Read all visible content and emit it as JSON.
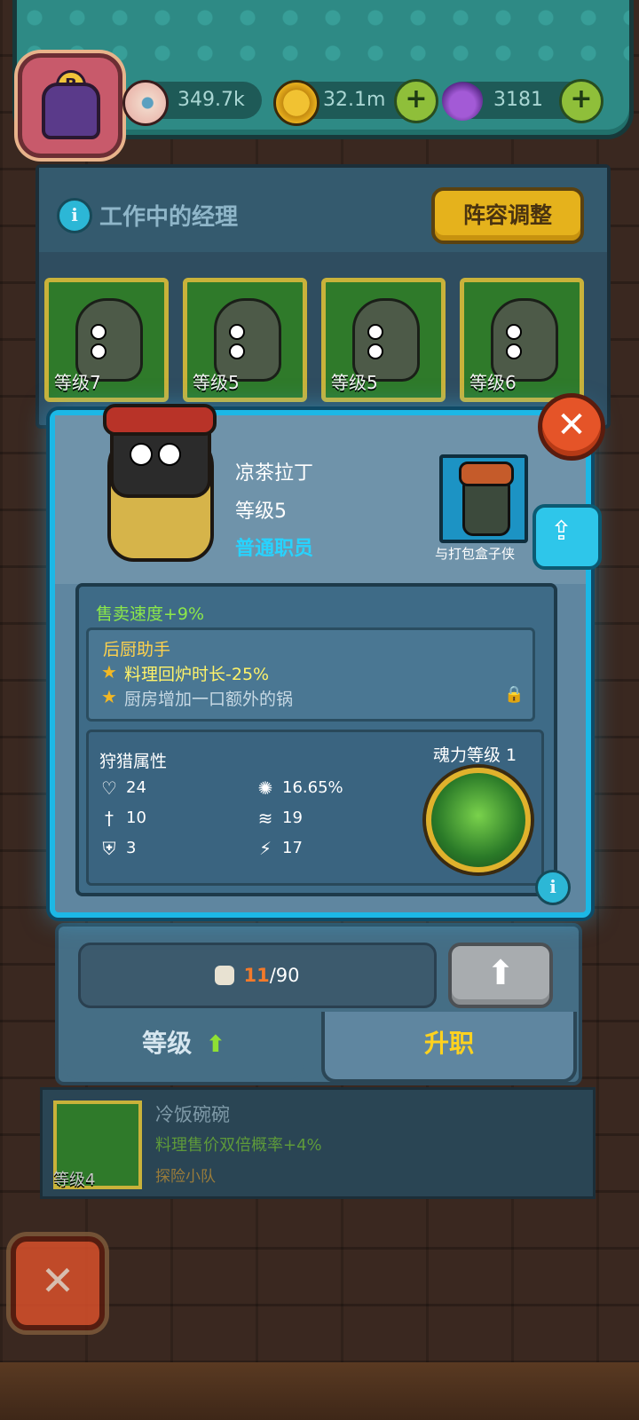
{
  "currency": {
    "eye": {
      "value": "349.7k",
      "icon": "eyeball-icon"
    },
    "coin": {
      "value": "32.1m",
      "icon": "coin-icon"
    },
    "potion": {
      "value": "3181",
      "icon": "potion-icon"
    }
  },
  "avatar": {
    "badge": "B"
  },
  "managers": {
    "title": "工作中的经理",
    "lineup_button": "阵容调整",
    "slots": [
      {
        "level": "等级7"
      },
      {
        "level": "等级5"
      },
      {
        "level": "等级5"
      },
      {
        "level": "等级6"
      }
    ]
  },
  "detail": {
    "name": "凉茶拉丁",
    "level": "等级5",
    "rank": "普通职员",
    "partner_label": "与打包盒子侠",
    "sell_speed": "售卖速度+9%",
    "skill": {
      "title": "后厨助手",
      "line1": "料理回炉时长-25%",
      "line2": "厨房增加一口额外的锅"
    },
    "hunt": {
      "title": "狩猎属性",
      "hp": "24",
      "attack": "10",
      "defense": "3",
      "crit": "16.65%",
      "dodge": "19",
      "speed": "17"
    },
    "soul": {
      "label": "魂力等级 1"
    }
  },
  "upgrade": {
    "current": "11",
    "total": "/90"
  },
  "tabs": {
    "level": "等级",
    "promote": "升职"
  },
  "list_row": {
    "name": "冷饭碗碗",
    "effect": "料理售价双倍概率+4%",
    "team": "探险小队",
    "level": "等级4"
  },
  "colors": {
    "accent_blue": "#1cb8e6",
    "promote_yellow": "#ffd21e",
    "sell_green": "#8ce84a"
  }
}
